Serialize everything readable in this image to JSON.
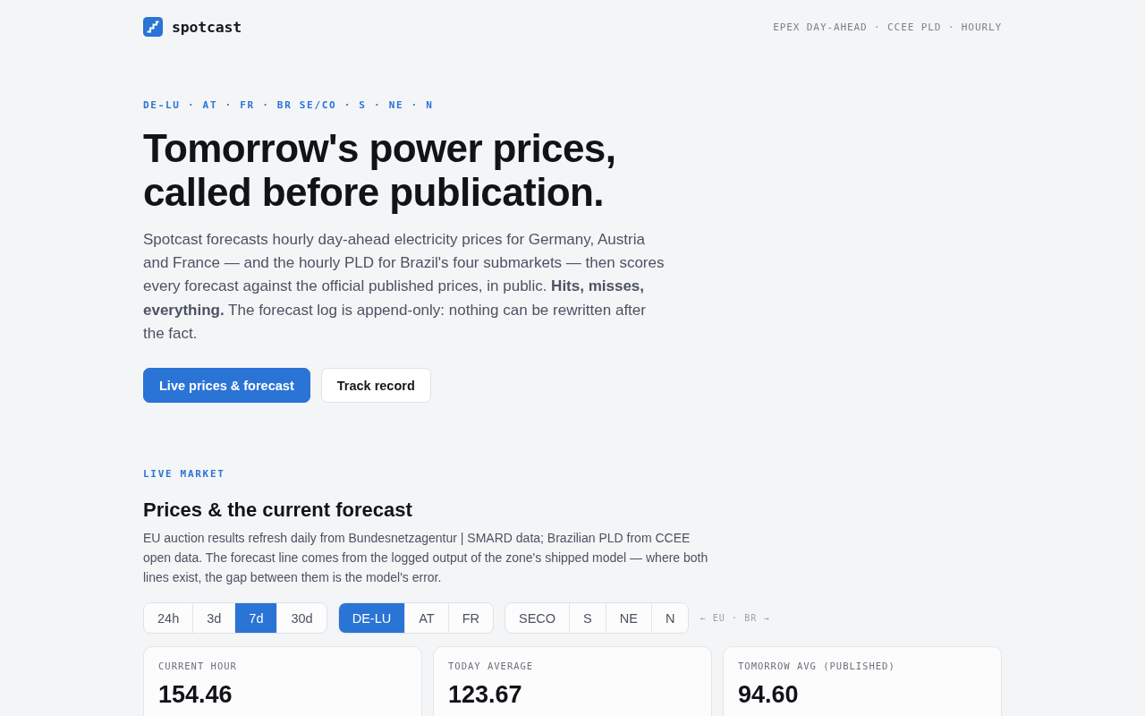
{
  "header": {
    "brand": "spotcast",
    "tagline": "EPEX DAY-AHEAD · CCEE PLD · HOURLY"
  },
  "hero": {
    "eyebrow": "DE-LU · AT · FR · BR SE/CO · S · NE · N",
    "title": "Tomorrow's power prices, called before publication.",
    "intro": "Spotcast forecasts hourly day-ahead electricity prices for Germany, Austria and France — and the hourly PLD for Brazil's four submarkets — then scores every forecast against the official published prices, in public. **Hits, misses, everything.** The forecast log is append-only: nothing can be rewritten after the fact.",
    "buttons": [
      {
        "label": "Live prices & forecast",
        "kind": "primary"
      },
      {
        "label": "Track record",
        "kind": "secondary"
      }
    ]
  },
  "live_market": {
    "eyebrow": "LIVE MARKET",
    "title": "Prices & the current forecast",
    "description": "EU auction results refresh daily from Bundesnetzagentur | SMARD data; Brazilian PLD from CCEE open data. The forecast line comes from the logged output of the zone's shipped model — where both lines exist, the gap between them is the model's error.",
    "control_groups": [
      {
        "options": [
          {
            "label": "24h",
            "selected": false
          },
          {
            "label": "3d",
            "selected": false
          },
          {
            "label": "7d",
            "selected": true
          },
          {
            "label": "30d",
            "selected": false
          }
        ]
      },
      {
        "options": [
          {
            "label": "DE-LU",
            "selected": true
          },
          {
            "label": "AT",
            "selected": false
          },
          {
            "label": "FR",
            "selected": false
          }
        ]
      },
      {
        "options": [
          {
            "label": "SECO",
            "selected": false
          },
          {
            "label": "S",
            "selected": false
          },
          {
            "label": "NE",
            "selected": false
          },
          {
            "label": "N",
            "selected": false
          }
        ]
      }
    ],
    "zone_hint": "← EU · BR →",
    "stats": [
      {
        "label": "CURRENT HOUR",
        "value": "154.46"
      },
      {
        "label": "TODAY AVERAGE",
        "value": "123.67"
      },
      {
        "label": "TOMORROW AVG (PUBLISHED)",
        "value": "94.60"
      }
    ]
  }
}
